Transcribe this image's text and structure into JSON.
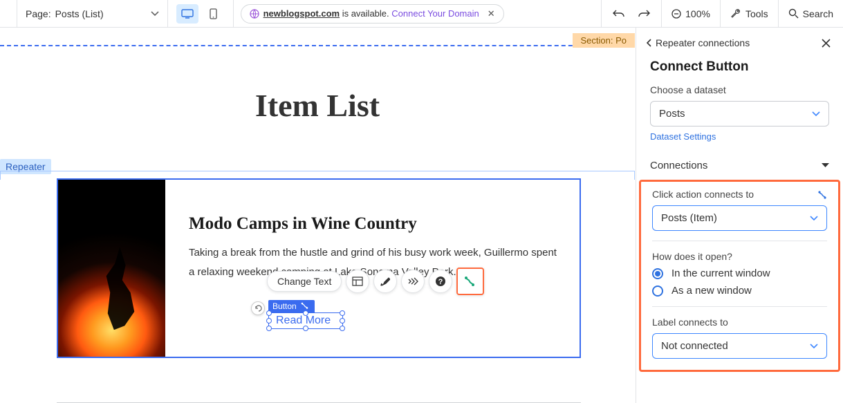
{
  "topbar": {
    "page_label": "Page:",
    "page_value": "Posts (List)",
    "domain_pill": {
      "domain": "newblogspot.com",
      "available_text": " is available.",
      "connect_text": "Connect Your Domain"
    },
    "zoom": "100%",
    "tools": "Tools",
    "search": "Search"
  },
  "canvas": {
    "section_tag": "Section: Po",
    "page_title": "Item List",
    "repeater_tag": "Repeater",
    "card": {
      "title": "Modo Camps in Wine Country",
      "desc": "Taking a break from the hustle and grind of his busy work week, Guillermo spent a relaxing weekend camping at Lake Sonoma Valley Park...."
    },
    "fab": {
      "change_text": "Change Text"
    },
    "selection": {
      "label": "Button",
      "button_text": "Read More"
    }
  },
  "panel": {
    "back_label": "Repeater connections",
    "title": "Connect Button",
    "choose_dataset_label": "Choose a dataset",
    "dataset_value": "Posts",
    "dataset_settings": "Dataset Settings",
    "connections_header": "Connections",
    "click_action_label": "Click action connects to",
    "click_action_value": "Posts (Item)",
    "open_label": "How does it open?",
    "open_option_current": "In the current window",
    "open_option_new": "As a new window",
    "label_connects_label": "Label connects to",
    "label_connects_value": "Not connected"
  }
}
